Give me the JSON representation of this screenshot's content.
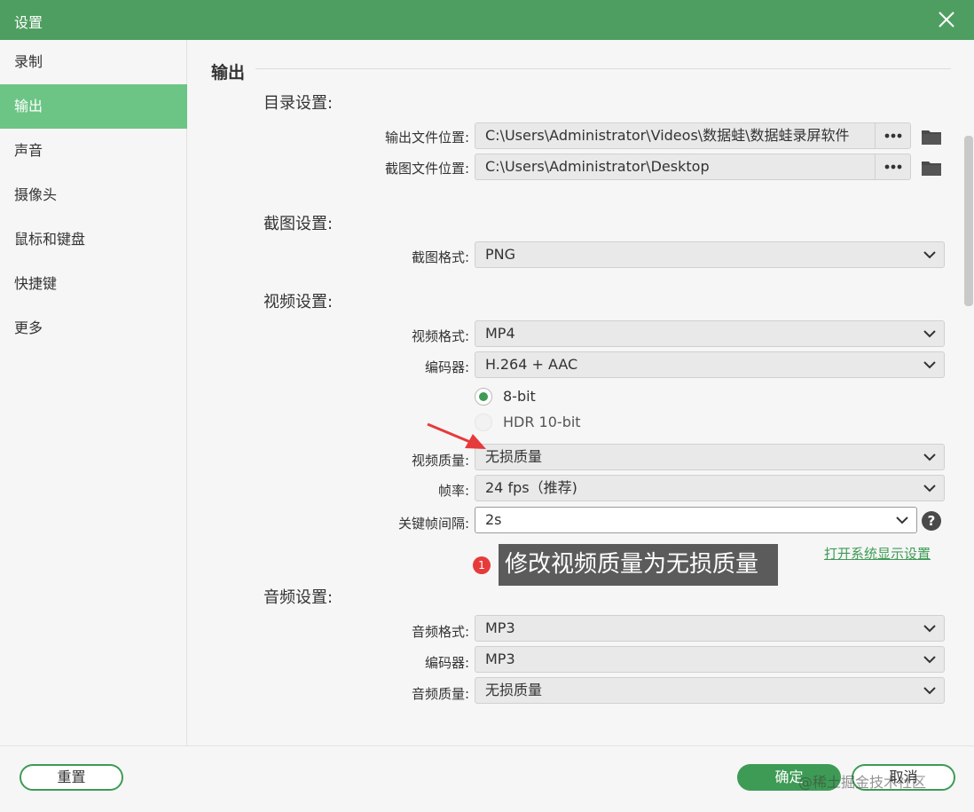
{
  "window": {
    "title": "设置"
  },
  "sidebar": {
    "items": [
      {
        "label": "录制"
      },
      {
        "label": "输出",
        "active": true
      },
      {
        "label": "声音"
      },
      {
        "label": "摄像头"
      },
      {
        "label": "鼠标和键盘"
      },
      {
        "label": "快捷键"
      },
      {
        "label": "更多"
      }
    ]
  },
  "main": {
    "section_title": "输出",
    "directory": {
      "title": "目录设置:",
      "output_label": "输出文件位置:",
      "output_value": "C:\\Users\\Administrator\\Videos\\数据蛙\\数据蛙录屏软件",
      "screenshot_label": "截图文件位置:",
      "screenshot_value": "C:\\Users\\Administrator\\Desktop"
    },
    "screenshot": {
      "title": "截图设置:",
      "format_label": "截图格式:",
      "format_value": "PNG"
    },
    "video": {
      "title": "视频设置:",
      "format_label": "视频格式:",
      "format_value": "MP4",
      "codec_label": "编码器:",
      "codec_value": "H.264 + AAC",
      "bit_8_label": "8-bit",
      "bit_8_selected": true,
      "hdr_label": "HDR 10-bit",
      "hdr_selected": false,
      "quality_label": "视频质量:",
      "quality_value": "无损质量",
      "fps_label": "帧率:",
      "fps_value": "24 fps（推荐)",
      "keyframe_label": "关键帧间隔:",
      "keyframe_value": "2s",
      "help_symbol": "?",
      "display_settings_link": "打开系统显示设置"
    },
    "audio": {
      "title": "音频设置:",
      "format_label": "音频格式:",
      "format_value": "MP3",
      "codec_label": "编码器:",
      "codec_value": "MP3",
      "quality_label": "音频质量:",
      "quality_value": "无损质量"
    }
  },
  "annotation": {
    "step_number": "1",
    "text": "修改视频质量为无损质量"
  },
  "footer": {
    "reset_label": "重置",
    "ok_label": "确定",
    "cancel_label": "取消",
    "watermark": "@稀土掘金技术社区"
  },
  "colors": {
    "titlebar": "#4f9e61",
    "sidebar_active": "#6cc585",
    "accent": "#3e9b55",
    "arrow": "#e63b3b"
  }
}
